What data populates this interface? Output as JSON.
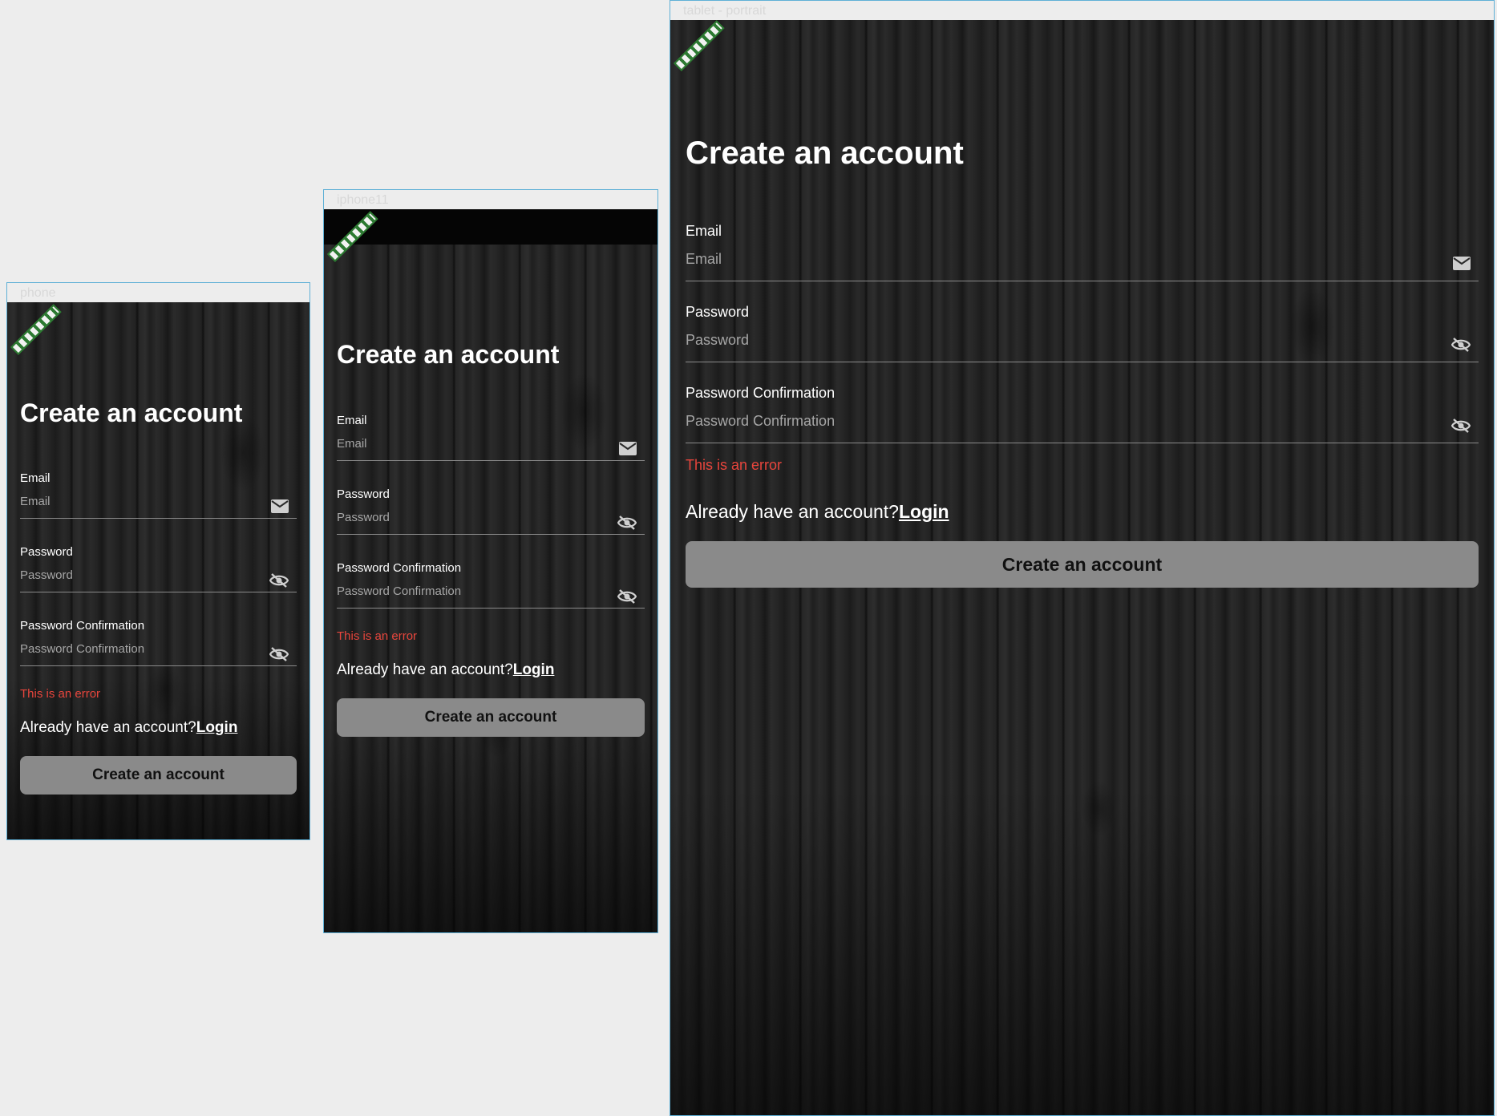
{
  "frames": [
    {
      "id": "phone",
      "label": "phone"
    },
    {
      "id": "iphone11",
      "label": "iphone11"
    },
    {
      "id": "tablet",
      "label": "tablet - portrait"
    }
  ],
  "form": {
    "title": "Create an account",
    "email_label": "Email",
    "email_placeholder": "Email",
    "email_icon": "mail-icon",
    "password_label": "Password",
    "password_placeholder": "Password",
    "password_icon": "eye-off-icon",
    "confirm_label": "Password Confirmation",
    "confirm_placeholder": "Password Confirmation",
    "confirm_icon": "eye-off-icon",
    "error_text": "This is an error",
    "login_prompt": "Already have an account?",
    "login_link": "Login",
    "submit_label": "Create an account"
  },
  "colors": {
    "error": "#e8453c",
    "button": "#8a8a8a",
    "frame_border": "#5fb0d6",
    "ruler": "#2d7a32",
    "canvas": "#ededed"
  }
}
